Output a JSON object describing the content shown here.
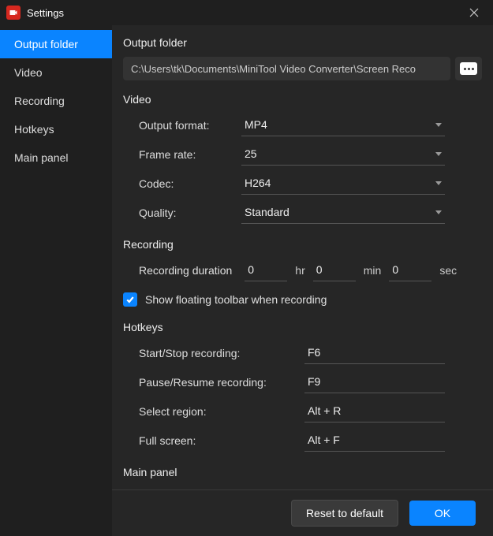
{
  "titlebar": {
    "label": "Settings"
  },
  "sidebar": {
    "items": [
      {
        "label": "Output folder",
        "active": true
      },
      {
        "label": "Video",
        "active": false
      },
      {
        "label": "Recording",
        "active": false
      },
      {
        "label": "Hotkeys",
        "active": false
      },
      {
        "label": "Main panel",
        "active": false
      }
    ]
  },
  "output_folder": {
    "heading": "Output folder",
    "path": "C:\\Users\\tk\\Documents\\MiniTool Video Converter\\Screen Reco"
  },
  "video": {
    "heading": "Video",
    "rows": {
      "format": {
        "label": "Output format:",
        "value": "MP4"
      },
      "frame_rate": {
        "label": "Frame rate:",
        "value": "25"
      },
      "codec": {
        "label": "Codec:",
        "value": "H264"
      },
      "quality": {
        "label": "Quality:",
        "value": "Standard"
      }
    }
  },
  "recording": {
    "heading": "Recording",
    "duration_label": "Recording duration",
    "hr": "0",
    "hr_unit": "hr",
    "min": "0",
    "min_unit": "min",
    "sec": "0",
    "sec_unit": "sec",
    "floating_label": "Show floating toolbar when recording",
    "floating_checked": true
  },
  "hotkeys": {
    "heading": "Hotkeys",
    "rows": {
      "start_stop": {
        "label": "Start/Stop recording:",
        "value": "F6"
      },
      "pause_resume": {
        "label": "Pause/Resume recording:",
        "value": "F9"
      },
      "select_region": {
        "label": "Select region:",
        "value": "Alt + R"
      },
      "full_screen": {
        "label": "Full screen:",
        "value": "Alt + F"
      }
    }
  },
  "main_panel": {
    "heading": "Main panel"
  },
  "footer": {
    "reset": "Reset to default",
    "ok": "OK"
  }
}
